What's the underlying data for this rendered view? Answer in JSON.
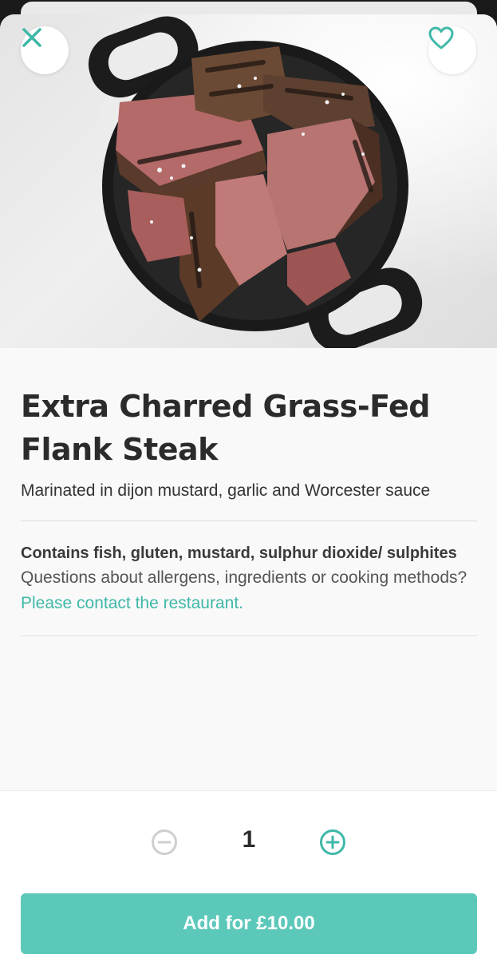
{
  "dish": {
    "title": "Extra Charred Grass-Fed Flank Steak",
    "description": "Marinated in dijon mustard, garlic and Worcester sauce",
    "allergens": "Contains fish, gluten, mustard, sulphur dioxide/ sulphites",
    "questions_text": "Questions about allergens, ingredients or cooking methods?",
    "contact_link": "Please contact the restaurant."
  },
  "header": {
    "close_icon": "close-icon",
    "favorite_icon": "heart-icon"
  },
  "quantity": {
    "value": "1",
    "minus_icon": "minus-circle-icon",
    "plus_icon": "plus-circle-icon"
  },
  "add_button": {
    "label": "Add for £10.00"
  },
  "colors": {
    "accent": "#5cc8ba",
    "link": "#3fb8a8",
    "text": "#2b2b2b"
  }
}
